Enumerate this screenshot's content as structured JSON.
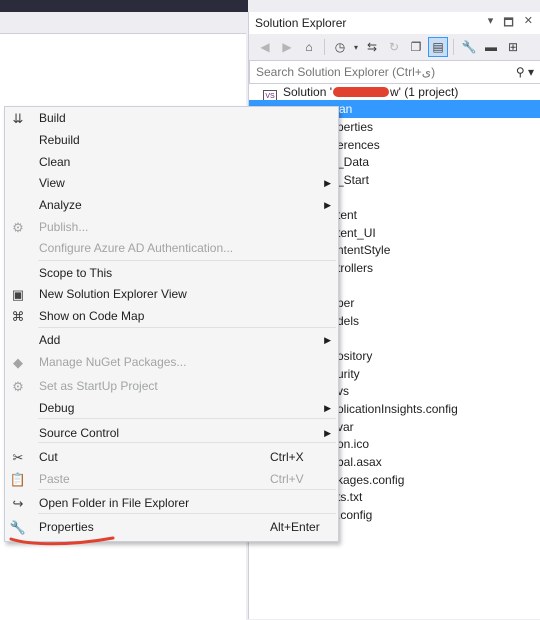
{
  "solution_explorer": {
    "title": "Solution Explorer",
    "title_buttons": [
      "▾",
      "🗖",
      "✕"
    ],
    "search_placeholder": "Search Solution Explorer (Ctrl+ی)",
    "solution_line": {
      "prefix": "Solution '",
      "suffix": "w' (1 project)"
    },
    "selected_item_text": "an",
    "items": [
      "perties",
      "erences",
      "_Data",
      "_Start",
      "tent",
      "tent_UI",
      "ntentStyle",
      "trollers",
      "per",
      "dels",
      "ository",
      "urity",
      "vs",
      "olicationInsights.config",
      "var",
      "on.ico",
      "bal.asax",
      "kages.config",
      "ts.txt",
      ".config"
    ]
  },
  "context_menu": {
    "items": [
      {
        "label": "Build",
        "icon": "build-icon"
      },
      {
        "label": "Rebuild"
      },
      {
        "label": "Clean"
      },
      {
        "label": "View",
        "submenu": true
      },
      {
        "label": "Analyze",
        "submenu": true
      },
      {
        "label": "Publish...",
        "disabled": true,
        "icon": "publish-icon"
      },
      {
        "label": "Configure Azure AD Authentication...",
        "disabled": true
      },
      {
        "label": "Scope to This"
      },
      {
        "label": "New Solution Explorer View",
        "icon": "new-view-icon"
      },
      {
        "label": "Show on Code Map",
        "icon": "code-map-icon"
      },
      {
        "label": "Add",
        "submenu": true
      },
      {
        "label": "Manage NuGet Packages...",
        "disabled": true,
        "icon": "nuget-icon"
      },
      {
        "label": "Set as StartUp Project",
        "disabled": true,
        "icon": "gear-icon"
      },
      {
        "label": "Debug",
        "submenu": true
      },
      {
        "label": "Source Control",
        "submenu": true
      },
      {
        "label": "Cut",
        "shortcut": "Ctrl+X",
        "icon": "scissors-icon"
      },
      {
        "label": "Paste",
        "shortcut": "Ctrl+V",
        "disabled": true,
        "icon": "paste-icon"
      },
      {
        "label": "Open Folder in File Explorer",
        "icon": "open-folder-icon"
      },
      {
        "label": "Properties",
        "shortcut": "Alt+Enter",
        "icon": "wrench-icon"
      }
    ]
  },
  "colors": {
    "selection": "#3399ff",
    "annotation": "#e0422f"
  }
}
